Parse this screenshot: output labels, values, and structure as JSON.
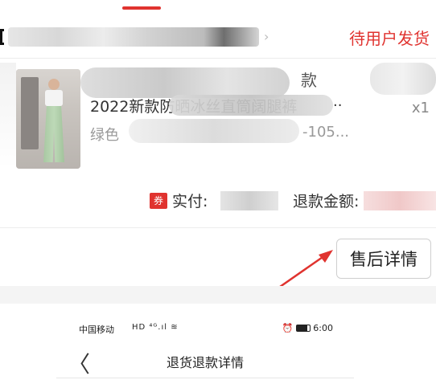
{
  "order": {
    "status": "待用户发货"
  },
  "product": {
    "title_top_fragment": "款",
    "title": "2022新款防晒冰丝直筒阔腿裤",
    "title_ellipsis": "..",
    "spec_prefix": "绿色",
    "spec_suffix": "-105...",
    "quantity": "x1",
    "image_icon": "product-photo"
  },
  "payment": {
    "coupon_badge": "券",
    "paid_label": "实付:",
    "refund_label": "退款金额:"
  },
  "actions": {
    "after_sale_label": "售后详情"
  },
  "annotation": {
    "arrow_color": "#e0332f"
  },
  "embedded_screen": {
    "carrier": "中国移动",
    "signal_icons": "HD ⁴ᴳ.ıl ≋",
    "time": "6:00",
    "back_icon": "chevron-left-icon",
    "title": "退货退款详情"
  },
  "colors": {
    "accent": "#e0332f"
  }
}
